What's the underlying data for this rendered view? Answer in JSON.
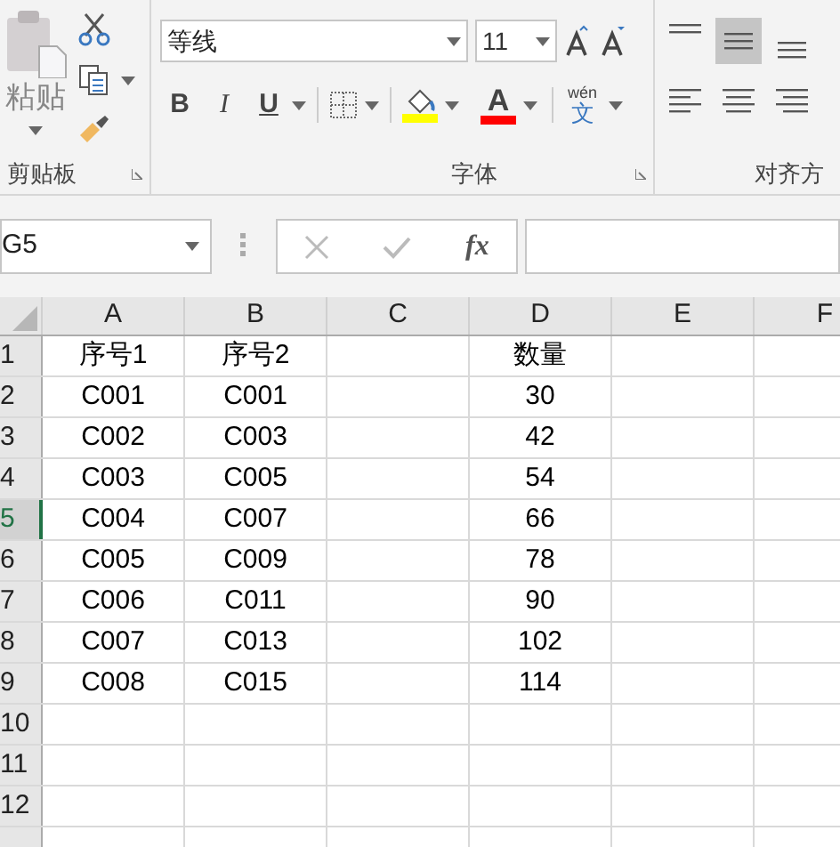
{
  "ribbon": {
    "clipboard": {
      "paste_label": "粘贴",
      "group_label": "剪贴板"
    },
    "font": {
      "font_name": "等线",
      "font_size": "11",
      "bold": "B",
      "italic": "I",
      "underline": "U",
      "font_color_letter": "A",
      "phonetic_top": "wén",
      "phonetic_char": "文",
      "group_label": "字体"
    },
    "alignment": {
      "vertical": [
        {
          "selected": false
        },
        {
          "selected": true
        },
        {
          "selected": false
        }
      ],
      "group_label": "对齐方"
    }
  },
  "name_box": "G5",
  "formula_fx": "fx",
  "columns": [
    "A",
    "B",
    "C",
    "D",
    "E",
    "F"
  ],
  "rows": [
    {
      "number": "1",
      "selected": false,
      "cells": [
        "序号1",
        "序号2",
        "",
        "数量",
        "",
        ""
      ]
    },
    {
      "number": "2",
      "selected": false,
      "cells": [
        "C001",
        "C001",
        "",
        "30",
        "",
        ""
      ]
    },
    {
      "number": "3",
      "selected": false,
      "cells": [
        "C002",
        "C003",
        "",
        "42",
        "",
        ""
      ]
    },
    {
      "number": "4",
      "selected": false,
      "cells": [
        "C003",
        "C005",
        "",
        "54",
        "",
        ""
      ]
    },
    {
      "number": "5",
      "selected": true,
      "cells": [
        "C004",
        "C007",
        "",
        "66",
        "",
        ""
      ]
    },
    {
      "number": "6",
      "selected": false,
      "cells": [
        "C005",
        "C009",
        "",
        "78",
        "",
        ""
      ]
    },
    {
      "number": "7",
      "selected": false,
      "cells": [
        "C006",
        "C011",
        "",
        "90",
        "",
        ""
      ]
    },
    {
      "number": "8",
      "selected": false,
      "cells": [
        "C007",
        "C013",
        "",
        "102",
        "",
        ""
      ]
    },
    {
      "number": "9",
      "selected": false,
      "cells": [
        "C008",
        "C015",
        "",
        "114",
        "",
        ""
      ]
    },
    {
      "number": "10",
      "selected": false,
      "cells": [
        "",
        "",
        "",
        "",
        "",
        ""
      ]
    },
    {
      "number": "11",
      "selected": false,
      "cells": [
        "",
        "",
        "",
        "",
        "",
        ""
      ]
    },
    {
      "number": "12",
      "selected": false,
      "cells": [
        "",
        "",
        "",
        "",
        "",
        ""
      ]
    }
  ]
}
